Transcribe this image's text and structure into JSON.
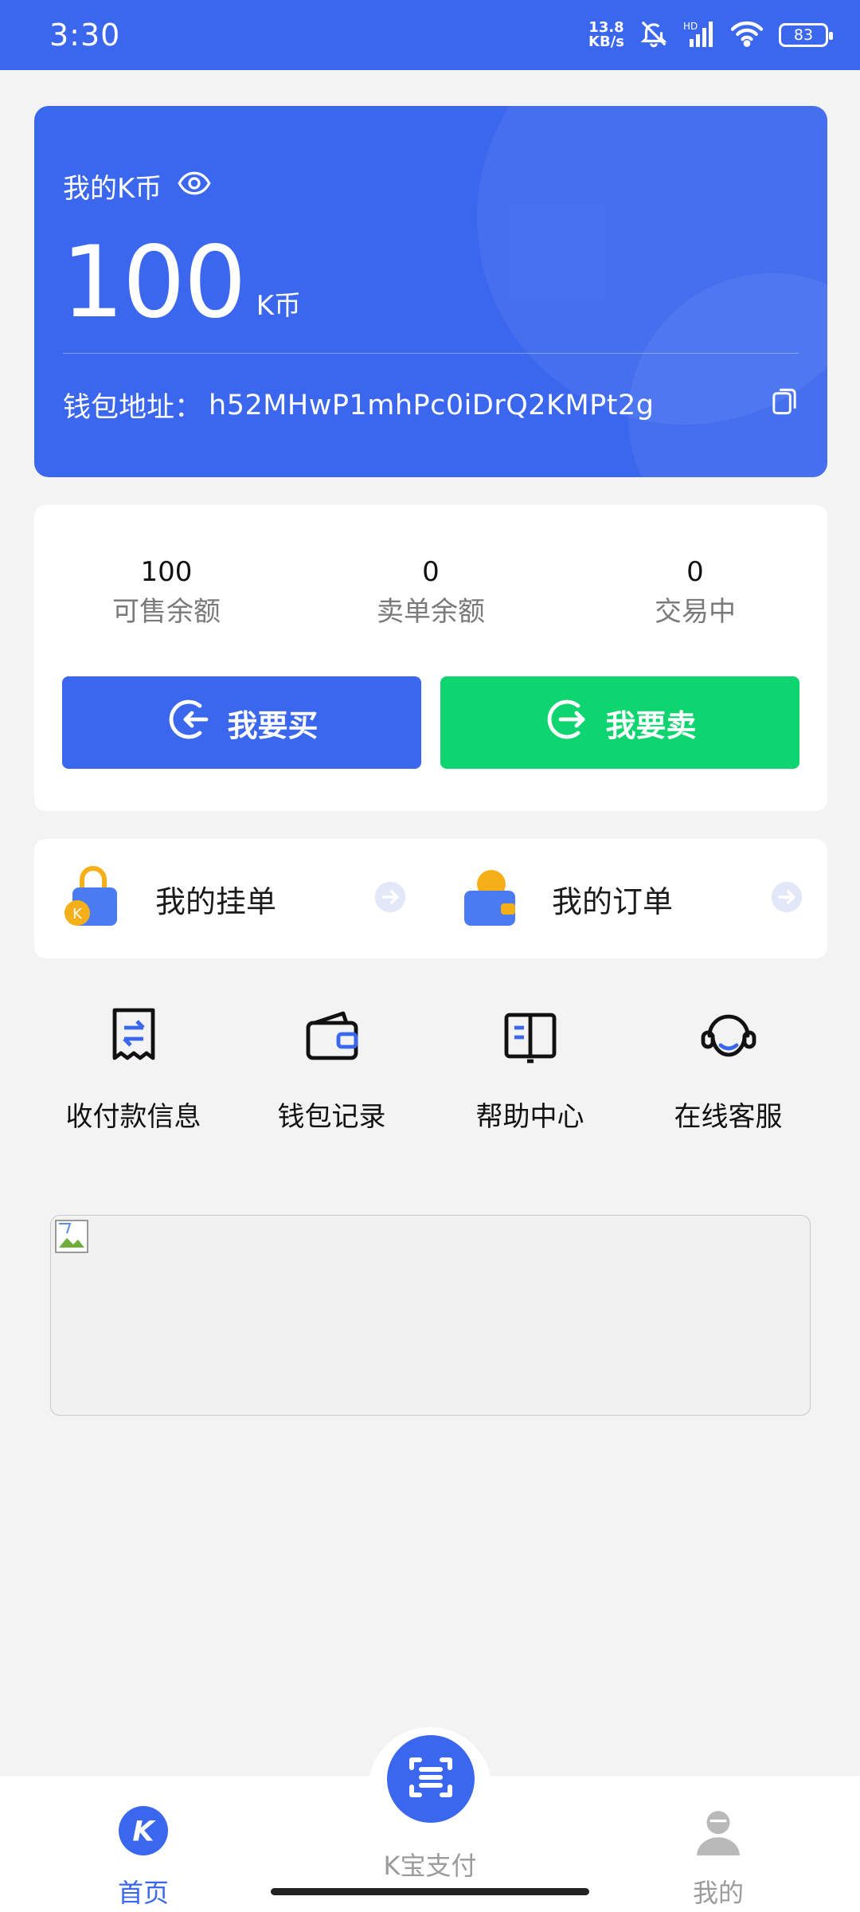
{
  "status_bar": {
    "time": "3:30",
    "net_speed_value": "13.8",
    "net_speed_unit": "KB/s",
    "battery": "83"
  },
  "balance_card": {
    "title": "我的K币",
    "amount": "100",
    "unit": "K币",
    "wallet_label": "钱包地址：",
    "wallet_address": "h52MHwP1mhPc0iDrQ2KMPt2g"
  },
  "stats": [
    {
      "value": "100",
      "label": "可售余额"
    },
    {
      "value": "0",
      "label": "卖单余额"
    },
    {
      "value": "0",
      "label": "交易中"
    }
  ],
  "actions": {
    "buy_label": "我要买",
    "sell_label": "我要卖"
  },
  "orders": {
    "listings_label": "我的挂单",
    "orders_label": "我的订单"
  },
  "quick_menu": [
    {
      "label": "收付款信息",
      "icon": "transfer-doc-icon"
    },
    {
      "label": "钱包记录",
      "icon": "wallet-icon"
    },
    {
      "label": "帮助中心",
      "icon": "book-icon"
    },
    {
      "label": "在线客服",
      "icon": "headset-icon"
    }
  ],
  "bottom_nav": {
    "home_label": "首页",
    "pay_label": "K宝支付",
    "mine_label": "我的"
  },
  "colors": {
    "primary": "#3a67ee",
    "sell": "#0ed56f",
    "background": "#f3f3f3"
  }
}
